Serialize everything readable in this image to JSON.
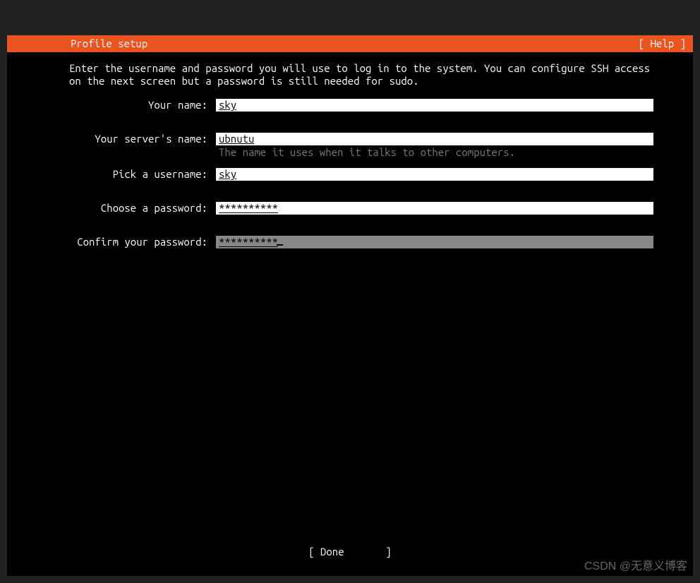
{
  "header": {
    "title": "Profile setup",
    "help": "[ Help ]"
  },
  "instructions": "Enter the username and password you will use to log in to the system. You can configure SSH access on the next screen but a password is still needed for sudo.",
  "fields": {
    "name": {
      "label": "Your name:",
      "value": "sky"
    },
    "server": {
      "label": "Your server's name:",
      "value": "ubnutu",
      "hint": "The name it uses when it talks to other computers."
    },
    "username": {
      "label": "Pick a username:",
      "value": "sky"
    },
    "password": {
      "label": "Choose a password:",
      "value": "**********"
    },
    "confirm": {
      "label": "Confirm your password:",
      "value": "**********"
    }
  },
  "footer": {
    "done": "[ Done       ]"
  },
  "watermark": "CSDN @无意义博客"
}
